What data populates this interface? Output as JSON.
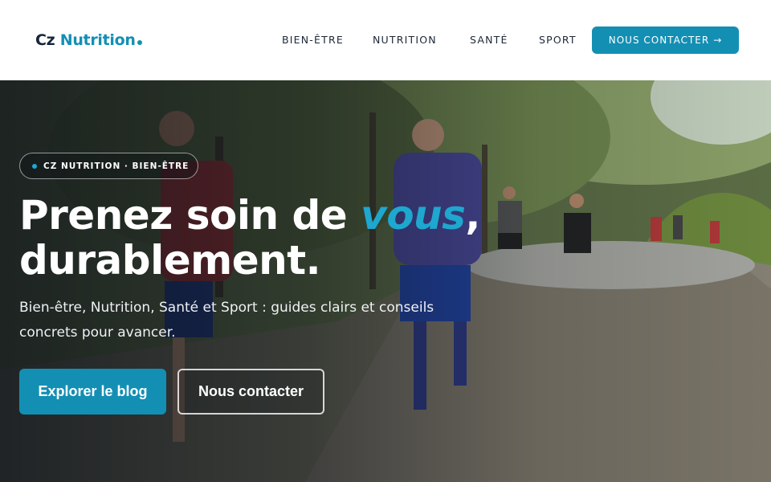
{
  "brand": {
    "logo_part1": "Cz",
    "logo_part2": "Nutrition",
    "accent_color": "#138fb4",
    "dark_color": "#15263a"
  },
  "nav": {
    "items": [
      {
        "label": "BIEN-ÊTRE"
      },
      {
        "label": "NUTRITION"
      },
      {
        "label": "SANTÉ"
      },
      {
        "label": "SPORT"
      }
    ],
    "cta_label": "NOUS CONTACTER",
    "cta_icon": "arrow-right-icon",
    "cta_arrow": "→"
  },
  "hero": {
    "badge": "CZ NUTRITION · BIEN-ÊTRE",
    "headline_part1": "Prenez soin de",
    "headline_accent": "vous",
    "headline_part2": ",",
    "headline_line2": "durablement.",
    "subtitle": "Bien-être, Nutrition, Santé et Sport : guides clairs et conseils concrets pour avancer.",
    "primary_button": "Explorer le blog",
    "secondary_button": "Nous contacter",
    "background_image": "runners-on-forest-trail"
  }
}
